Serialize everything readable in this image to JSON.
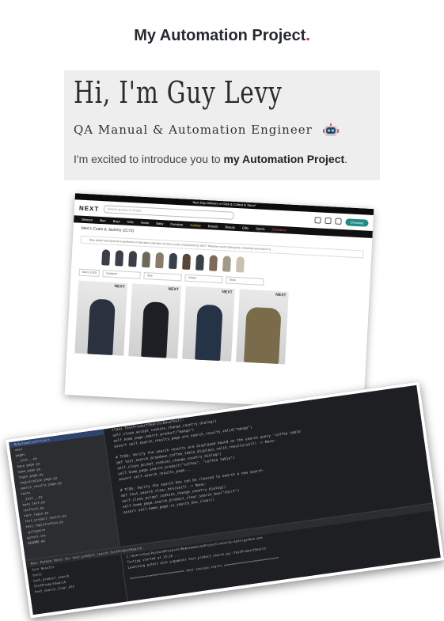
{
  "title": {
    "text": "My Automation Project",
    "dot": "."
  },
  "intro": {
    "name": "Hi, I'm Guy Levy",
    "role": "QA Manual & Automation Engineer",
    "text_before": "I'm excited to introduce you to ",
    "text_bold": "my Automation Project",
    "text_after": "."
  },
  "web_screenshot": {
    "banner": "Next Day Delivery or Click & Collect in Store*",
    "logo": "NEXT",
    "search_placeholder": "Search product or brand",
    "checkout": "Checkout",
    "nav": [
      "Women",
      "Men",
      "Boys",
      "Girls",
      "Home",
      "Baby",
      "Furniture",
      "Holiday",
      "Brands",
      "Beauty",
      "Gifts",
      "Sports",
      "Clearance"
    ],
    "heading": "Men's Coats & Jackets (2170)",
    "description": "Stay stylish and layered to perfection in the latest collection of men's coats and jackets by NEXT. Whether you're looking for a timeless overcoat in cl...",
    "filters": [
      "Men's (293)",
      "Category",
      "Size",
      "Colour",
      "Style"
    ],
    "brand": "NEXT"
  },
  "ide_screenshot": {
    "project": "MyAutomationProject",
    "tree": [
      "MyAutomationProject",
      "venv",
      "pages",
      "__init__.py",
      "base_page.py",
      "home_page.py",
      "login_page.py",
      "registration_page.py",
      "search_results_page.py",
      "tests",
      "__init__.py",
      "base_test.py",
      "conftest.py",
      "test_login.py",
      "test_product_search.py",
      "test_registration.py",
      ".gitignore",
      "pytest.ini",
      "README.md"
    ],
    "code": [
      "class TestProductSearch(BaseTest):",
      "    self.close_accept_cookies_change_country_dialog()",
      "    self.home_page.search_product(\"mango\")",
      "    assert self.search_results_page.are_search_results_valid(\"mango\")",
      "",
      "  # TC04: Verify the search results are displayed based on the search query 'coffee table'",
      "  def test_search_dropdown_coffee_table_displays_valid_results(self) -> None:",
      "    self.close_accept_cookies_change_country_dialog()",
      "    self.home_page.search_product(\"coffee\", \"coffee table\")",
      "    assert self.search_results_page...",
      "",
      "  # TC05: Verify the search box can be cleared to search a new search",
      "  def test_search_clear_btn(self) -> None:",
      "    self.close_accept_cookies_change_country_dialog()",
      "    self.home_page.search_product_clear_search_box(\"shirt\")",
      "    assert self.home_page.is_search_box_clear()"
    ],
    "run_bar": "Run: Python tests for test_product_search.TestProductSearch",
    "tests": [
      "Test Results",
      "tests",
      "test_product_search",
      "TestProductSearch",
      "test_search_clear_btn"
    ],
    "output": [
      "C:\\Users\\Guy\\PycharmProjects\\MyAutomationProject\\venv\\Scripts\\python.exe",
      "Testing started at 13:16 ...",
      "Launching pytest with arguments test_product_search.py::TestProductSearch",
      "",
      "============================= test session starts ============================="
    ]
  }
}
